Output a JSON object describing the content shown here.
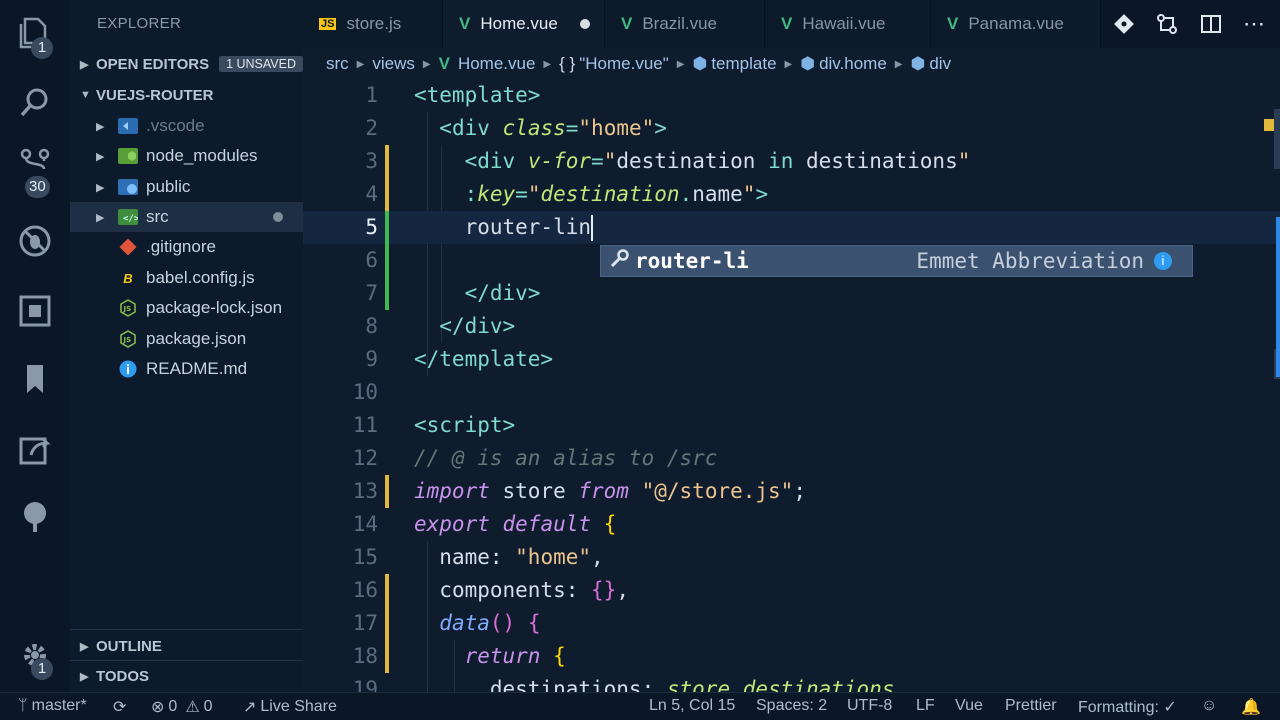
{
  "activity_bar": {
    "explorer_badge": "1",
    "scm_badge": "30",
    "settings_badge": "1"
  },
  "sidebar": {
    "title": "EXPLORER",
    "open_editors": {
      "label": "OPEN EDITORS",
      "badge": "1 UNSAVED"
    },
    "project": "VUEJS-ROUTER",
    "items": [
      {
        "name": ".vscode",
        "icon": "vscode-folder-icon"
      },
      {
        "name": "node_modules",
        "icon": "node-folder-icon"
      },
      {
        "name": "public",
        "icon": "public-folder-icon"
      },
      {
        "name": "src",
        "icon": "src-folder-icon"
      },
      {
        "name": ".gitignore",
        "icon": "git-icon"
      },
      {
        "name": "babel.config.js",
        "icon": "babel-icon"
      },
      {
        "name": "package-lock.json",
        "icon": "npm-icon"
      },
      {
        "name": "package.json",
        "icon": "npm-icon"
      },
      {
        "name": "README.md",
        "icon": "info-icon"
      }
    ],
    "outline": "OUTLINE",
    "todos": "TODOS"
  },
  "tabs": [
    {
      "label": "store.js",
      "icon": "js-icon"
    },
    {
      "label": "Home.vue",
      "icon": "vue-icon",
      "active": true,
      "dirty": true
    },
    {
      "label": "Brazil.vue",
      "icon": "vue-icon"
    },
    {
      "label": "Hawaii.vue",
      "icon": "vue-icon"
    },
    {
      "label": "Panama.vue",
      "icon": "vue-icon"
    }
  ],
  "breadcrumb": {
    "src": "src",
    "views": "views",
    "file": "Home.vue",
    "obj": "\"Home.vue\"",
    "obj_prefix": "{ }",
    "template": "template",
    "div_home": "div.home",
    "div": "div"
  },
  "editor": {
    "current_line": 5,
    "line_numbers": [
      "1",
      "2",
      "3",
      "4",
      "5",
      "6",
      "7",
      "8",
      "9",
      "10",
      "11",
      "12",
      "13",
      "14",
      "15",
      "16",
      "17",
      "18",
      "19"
    ]
  },
  "suggest": {
    "label": "router-li",
    "detail": "Emmet Abbreviation",
    "info": "i"
  },
  "status": {
    "branch": "master*",
    "errors": "0",
    "warnings": "0",
    "live_share": "Live Share",
    "position": "Ln 5, Col 15",
    "spaces": "Spaces: 2",
    "encoding": "UTF-8",
    "eol": "LF",
    "language": "Vue",
    "prettier": "Prettier",
    "formatting": "Formatting: ✓"
  },
  "colors": {
    "tag": "#7fdbca",
    "attr": "#c5e478",
    "string": "#ecc48d",
    "keyword": "#c792ea",
    "vue_green": "#41b883",
    "js_yellow": "#f5c518",
    "modified_mark": "#e2b93d",
    "added_mark": "#3fb950"
  }
}
